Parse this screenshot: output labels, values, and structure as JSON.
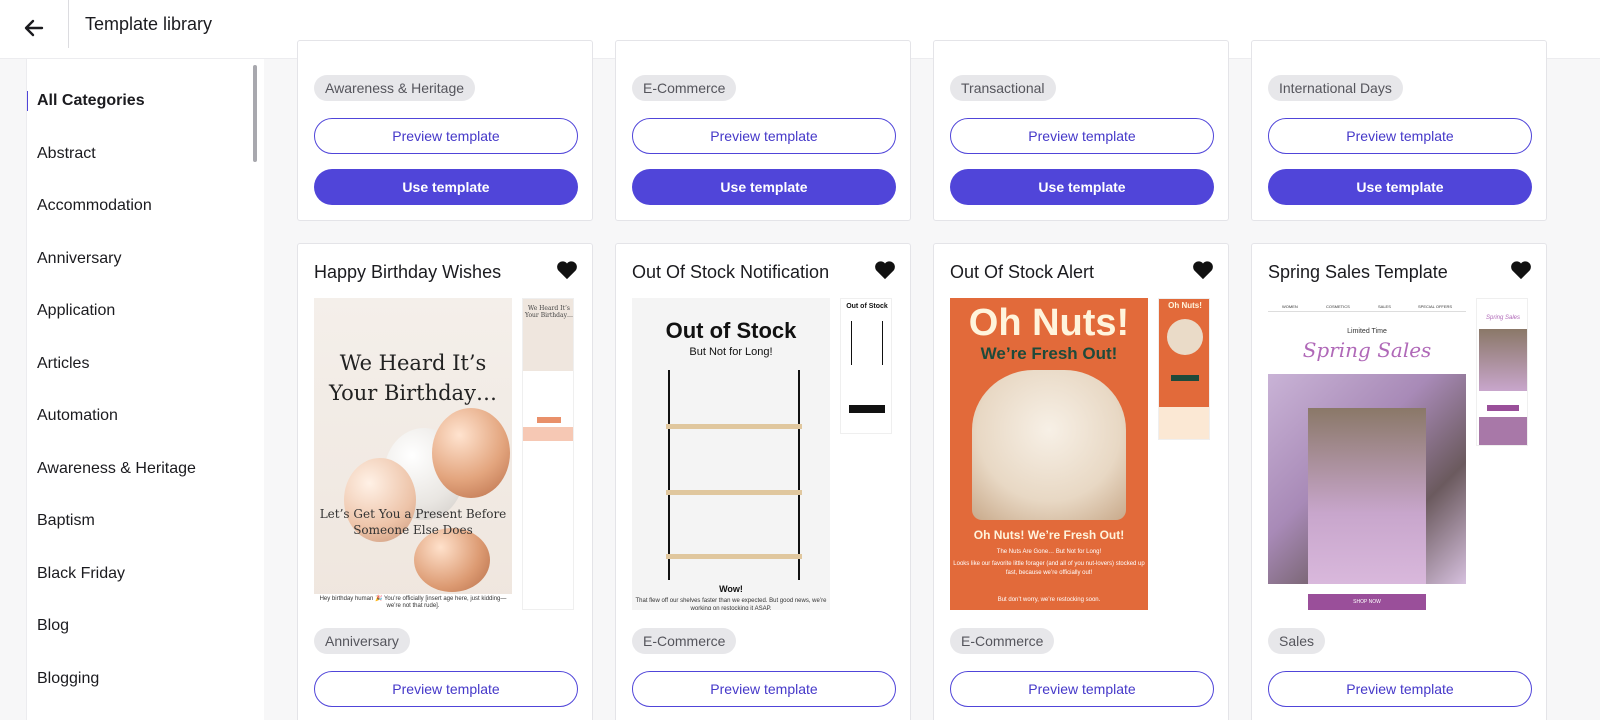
{
  "header": {
    "title": "Template library"
  },
  "sidebar": {
    "categories": [
      {
        "label": "All Categories"
      },
      {
        "label": "Abstract"
      },
      {
        "label": "Accommodation"
      },
      {
        "label": "Anniversary"
      },
      {
        "label": "Application"
      },
      {
        "label": "Articles"
      },
      {
        "label": "Automation"
      },
      {
        "label": "Awareness & Heritage"
      },
      {
        "label": "Baptism"
      },
      {
        "label": "Black Friday"
      },
      {
        "label": "Blog"
      },
      {
        "label": "Blogging"
      }
    ],
    "active": "All Categories"
  },
  "top_cards": [
    {
      "tag": "Awareness & Heritage",
      "preview_label": "Preview template",
      "use_label": "Use template"
    },
    {
      "tag": "E-Commerce",
      "preview_label": "Preview template",
      "use_label": "Use template"
    },
    {
      "tag": "Transactional",
      "preview_label": "Preview template",
      "use_label": "Use template"
    },
    {
      "tag": "International Days",
      "preview_label": "Preview template",
      "use_label": "Use template"
    }
  ],
  "cards": [
    {
      "title": "Happy Birthday Wishes",
      "tag": "Anniversary",
      "preview_label": "Preview template",
      "thumb": {
        "headline": "We Heard It’s Your Birthday…",
        "sub": "Let’s Get You a Present Before Someone Else Does",
        "foot": "Hey birthday human 🎉 You’re officially [insert age here, just kidding—we’re not that rude]."
      }
    },
    {
      "title": "Out Of Stock Notification",
      "tag": "E-Commerce",
      "preview_label": "Preview template",
      "thumb": {
        "headline": "Out of Stock",
        "sub": "But Not for Long!",
        "wow": "Wow!",
        "foot": "That flew off our shelves faster than we expected. But good news, we’re working on restocking it ASAP."
      }
    },
    {
      "title": "Out Of Stock Alert",
      "tag": "E-Commerce",
      "preview_label": "Preview template",
      "thumb": {
        "headline": "Oh Nuts!",
        "sub": "We’re Fresh Out!",
        "caption": "Oh Nuts! We’re Fresh Out!",
        "line1": "The Nuts Are Gone… But Not for Long!",
        "line2": "Looks like our favorite little forager (and all of you nut-lovers) stocked up fast, because we’re officially out!",
        "line3": "But don’t worry, we’re restocking soon."
      }
    },
    {
      "title": "Spring Sales Template",
      "tag": "Sales",
      "preview_label": "Preview template",
      "thumb": {
        "nav": [
          "WOMEN",
          "COSMETICS",
          "SALES",
          "SPECIAL OFFERS"
        ],
        "kicker": "Limited Time",
        "headline": "Spring Sales",
        "cta": "SHOP NOW"
      }
    }
  ],
  "colors": {
    "accent": "#5045d9",
    "tag_bg": "#e7e7ea",
    "nuts_bg": "#e26a3a",
    "spring_accent": "#b069b8"
  },
  "icons": {
    "back": "arrow-left-icon",
    "favorite": "heart-icon"
  }
}
